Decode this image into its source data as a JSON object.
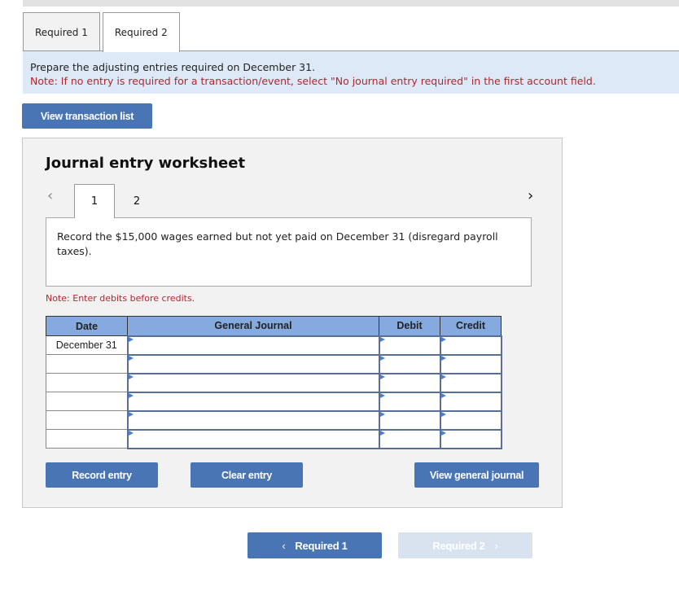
{
  "tabs": [
    {
      "label": "Required 1",
      "active": false
    },
    {
      "label": "Required 2",
      "active": true
    }
  ],
  "instructions": {
    "main": "Prepare the adjusting entries required on December 31.",
    "note": "Note: If no entry is required for a transaction/event, select \"No journal entry required\" in the first account field."
  },
  "buttons": {
    "view_transaction_list": "View transaction list",
    "record_entry": "Record entry",
    "clear_entry": "Clear entry",
    "view_general_journal": "View general journal",
    "prev_required": "Required 1",
    "next_required": "Required 2"
  },
  "worksheet": {
    "title": "Journal entry worksheet",
    "pages": [
      "1",
      "2"
    ],
    "active_page": "1",
    "prev_icon": "‹",
    "next_icon": "›",
    "description": "Record the $15,000 wages earned but not yet paid on December 31 (disregard payroll taxes).",
    "note": "Note: Enter debits before credits.",
    "columns": [
      "Date",
      "General Journal",
      "Debit",
      "Credit"
    ],
    "rows": [
      {
        "date": "December 31",
        "account": "",
        "debit": "",
        "credit": ""
      },
      {
        "date": "",
        "account": "",
        "debit": "",
        "credit": ""
      },
      {
        "date": "",
        "account": "",
        "debit": "",
        "credit": ""
      },
      {
        "date": "",
        "account": "",
        "debit": "",
        "credit": ""
      },
      {
        "date": "",
        "account": "",
        "debit": "",
        "credit": ""
      },
      {
        "date": "",
        "account": "",
        "debit": "",
        "credit": ""
      }
    ]
  },
  "colors": {
    "primary": "#4a75b4",
    "header": "#84aadf",
    "note": "#b0272d",
    "disabled": "#d9e3f0"
  }
}
